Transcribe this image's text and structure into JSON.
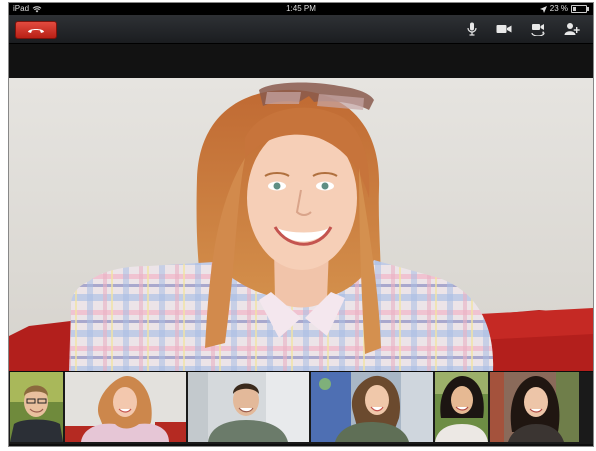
{
  "status_bar": {
    "device": "iPad",
    "time": "1:45 PM",
    "battery": "23 %",
    "battery_level": 0.23
  },
  "toolbar": {
    "hangup_icon": "phone-hangup-icon",
    "buttons": [
      "microphone-icon",
      "video-camera-icon",
      "switch-camera-icon",
      "add-person-icon"
    ]
  },
  "colors": {
    "hangup": "#d9372c",
    "toolbar": "#25282c"
  },
  "participants": [
    {
      "name": "participant-1"
    },
    {
      "name": "participant-2"
    },
    {
      "name": "participant-3"
    },
    {
      "name": "participant-4"
    },
    {
      "name": "participant-5"
    },
    {
      "name": "participant-6"
    }
  ]
}
